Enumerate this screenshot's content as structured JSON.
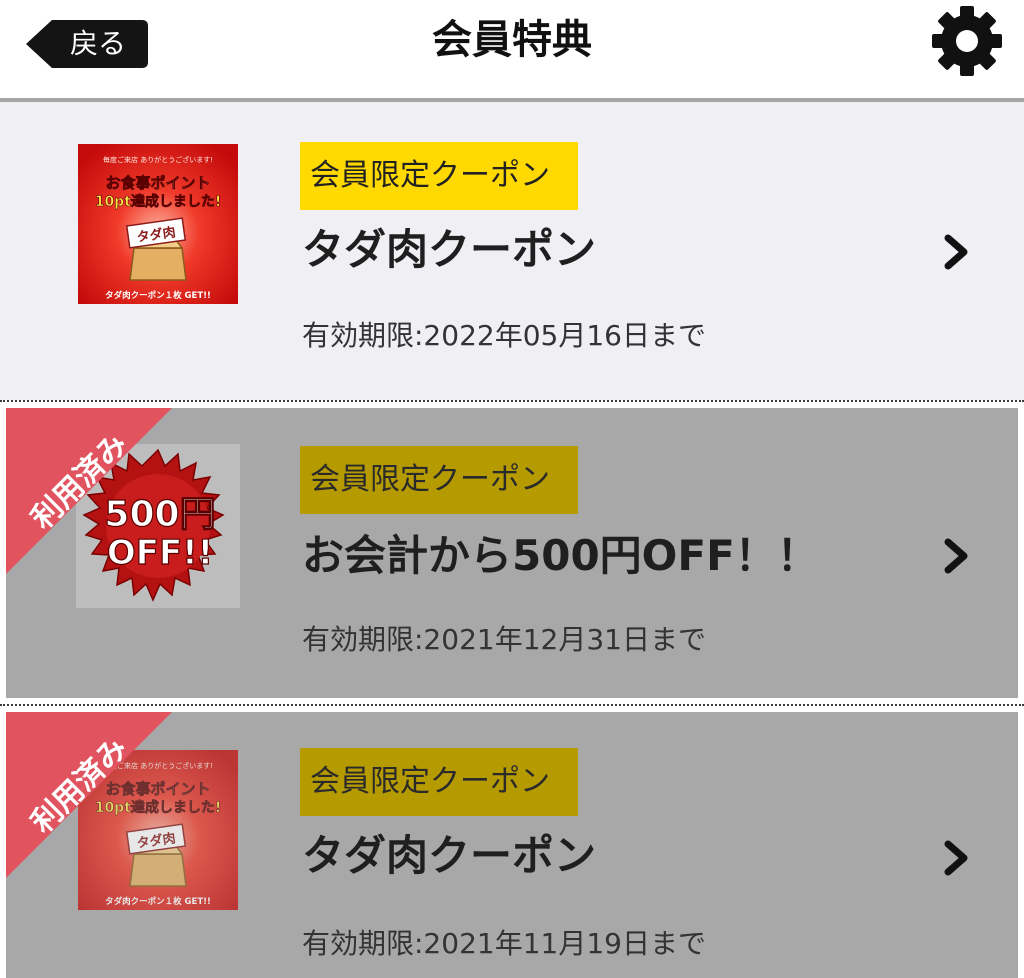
{
  "header": {
    "back_label": "戻る",
    "title": "会員特典",
    "settings_icon": "gear-icon"
  },
  "coupons": [
    {
      "tag": "会員限定クーポン",
      "title": "タダ肉クーポン",
      "expiry": "有効期限:2022年05月16日まで",
      "used": false,
      "image": {
        "kind": "meat-points",
        "line1": "毎度ご来店 ありがとうございます!",
        "line2": "お食事ポイント",
        "line3": "10pt達成しました!",
        "box_label": "タダ肉",
        "footer": "タダ肉クーポン１枚 GET!!"
      }
    },
    {
      "tag": "会員限定クーポン",
      "title": "お会計から500円OFF！！",
      "expiry": "有効期限:2021年12月31日まで",
      "used": true,
      "used_label": "利用済み",
      "image": {
        "kind": "discount-burst",
        "line1": "500円",
        "line2": "OFF!!"
      }
    },
    {
      "tag": "会員限定クーポン",
      "title": "タダ肉クーポン",
      "expiry": "有効期限:2021年11月19日まで",
      "used": true,
      "used_label": "利用済み",
      "image": {
        "kind": "meat-points",
        "line1": "毎度ご来店 ありがとうございます!",
        "line2": "お食事ポイント",
        "line3": "10pt達成しました!",
        "box_label": "タダ肉",
        "footer": "タダ肉クーポン１枚 GET!!"
      }
    }
  ],
  "colors": {
    "tag_active": "#ffd900",
    "tag_used": "#b59a00",
    "card_active": "#efeff4",
    "card_used": "#a8a8a8",
    "ribbon": "#e0535f",
    "coupon_red": "#d80f0f"
  }
}
